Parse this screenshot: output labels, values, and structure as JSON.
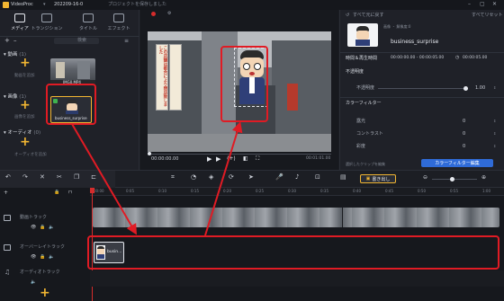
{
  "app": {
    "title": "VideoProc",
    "project": "202209-16-0",
    "status": "プロジェクトを保存しました"
  },
  "colors": {
    "accent": "#f2b632",
    "highlight": "#e01b24",
    "button_blue": "#2f6bd8",
    "playhead": "#d52c2c"
  },
  "left_panel": {
    "tabs": [
      {
        "label": "メディア",
        "icon": "media-icon"
      },
      {
        "label": "トランジション",
        "icon": "transition-icon"
      },
      {
        "label": "タイトル",
        "icon": "title-icon"
      },
      {
        "label": "エフェクト",
        "icon": "effect-icon"
      }
    ],
    "search_placeholder": "検索",
    "sections": [
      {
        "label": "動画",
        "count": "(1)",
        "hint": "動画を追加"
      },
      {
        "label": "画像",
        "count": "(1)",
        "hint": "画像を追加"
      },
      {
        "label": "オーディオ",
        "count": "(0)",
        "hint": "オーディオを追加"
      }
    ],
    "video_item": {
      "name": "IMG0.MP4"
    },
    "image_item": {
      "name": "business_surprise"
    }
  },
  "preview": {
    "sign_text": "この店舗は都合により閉店致しました",
    "timecode": "00:00:00.00",
    "duration": "00:01:01.00"
  },
  "right_panel": {
    "header_link": "すべて元に戻す",
    "header_back": "すべてリセット",
    "asset_name": "business_surprise",
    "asset_info": "画像 ・ 解像度:0",
    "position_label": "時間＆再生時間",
    "start_time": "00:00:00.00 - 00:00:05.00",
    "duration_time": "00:00:05.00",
    "opacity_section": "不透明度",
    "opacity_label": "不透明度",
    "opacity_value": "1.00",
    "color_section": "カラーフィルター",
    "color_rows": [
      {
        "label": "露光",
        "value": "0"
      },
      {
        "label": "コントラスト",
        "value": "0"
      },
      {
        "label": "彩度",
        "value": "0"
      }
    ],
    "color_button": "カラーフィルター編集",
    "color_hint": "選択したクリップを編集"
  },
  "toolbar": {
    "left_buttons": [
      "元に戻す",
      "やり直す",
      "削除",
      "分割",
      "コピー",
      "トリミング",
      "クロップ"
    ],
    "center_buttons": [
      "スピード",
      "ブランド",
      "ローテーション",
      "モーション",
      "音声",
      "ナレーション",
      "サイズ",
      "メタデータ",
      "エクスポート"
    ],
    "export_label": "書き出し"
  },
  "timeline": {
    "ruler": [
      "00:00",
      "0:05",
      "0:10",
      "0:15",
      "0:20",
      "0:25",
      "0:30",
      "0:35",
      "0:40",
      "0:45",
      "0:50",
      "0:55",
      "1:00"
    ],
    "tracks": [
      {
        "name": "動画トラック",
        "icon": "video-track-icon"
      },
      {
        "name": "オーバーレイトラック",
        "icon": "overlay-track-icon"
      },
      {
        "name": "オーディオトラック",
        "icon": "audio-track-icon"
      }
    ],
    "overlay_clip_label": "busin..."
  }
}
